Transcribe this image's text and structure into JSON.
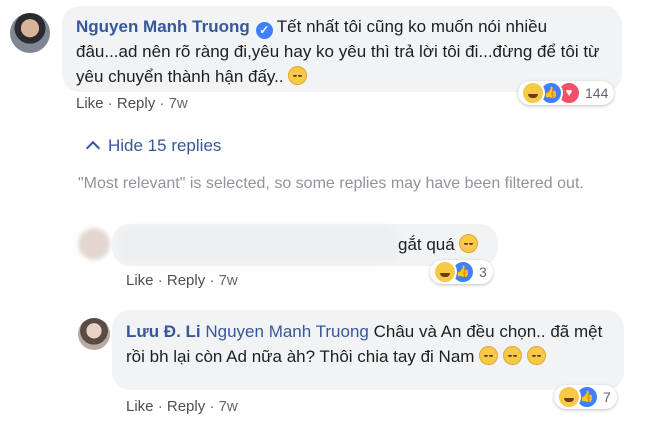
{
  "comment1": {
    "author": "Nguyen Manh Truong",
    "verified_icon": "verified-check-icon",
    "text": "Tết nhất tôi cũng ko muốn nói nhiều đâu...ad nên rõ ràng đi,yêu hay ko yêu thì trả lời tôi đi...đừng để tôi từ yêu chuyển thành hận đấy..",
    "emoji": "tired-face-emoji",
    "like_label": "Like",
    "reply_label": "Reply",
    "time": "7w",
    "reaction_count": "144",
    "reaction_icons": [
      "haha-reaction-icon",
      "like-reaction-icon",
      "love-reaction-icon"
    ]
  },
  "hide_replies": {
    "label": "Hide 15 replies"
  },
  "filter_notice": "\"Most relevant\" is selected, so some replies may have been filtered out.",
  "reply1": {
    "text": "gắt quá",
    "emoji": "laughing-tears-emoji",
    "like_label": "Like",
    "reply_label": "Reply",
    "time": "7w",
    "reaction_count": "3"
  },
  "reply2": {
    "author": "Lưu Đ. Li",
    "mention": "Nguyen Manh Truong",
    "text": "Châu và An đều chọn.. đã mệt rồi bh lại còn Ad nữa àh? Thôi chia tay đi Nam",
    "like_label": "Like",
    "reply_label": "Reply",
    "time": "7w",
    "reaction_count": "7"
  },
  "colors": {
    "link": "#365899",
    "bubble": "#f2f3f5",
    "meta": "#606770",
    "verified": "#4080ff"
  }
}
